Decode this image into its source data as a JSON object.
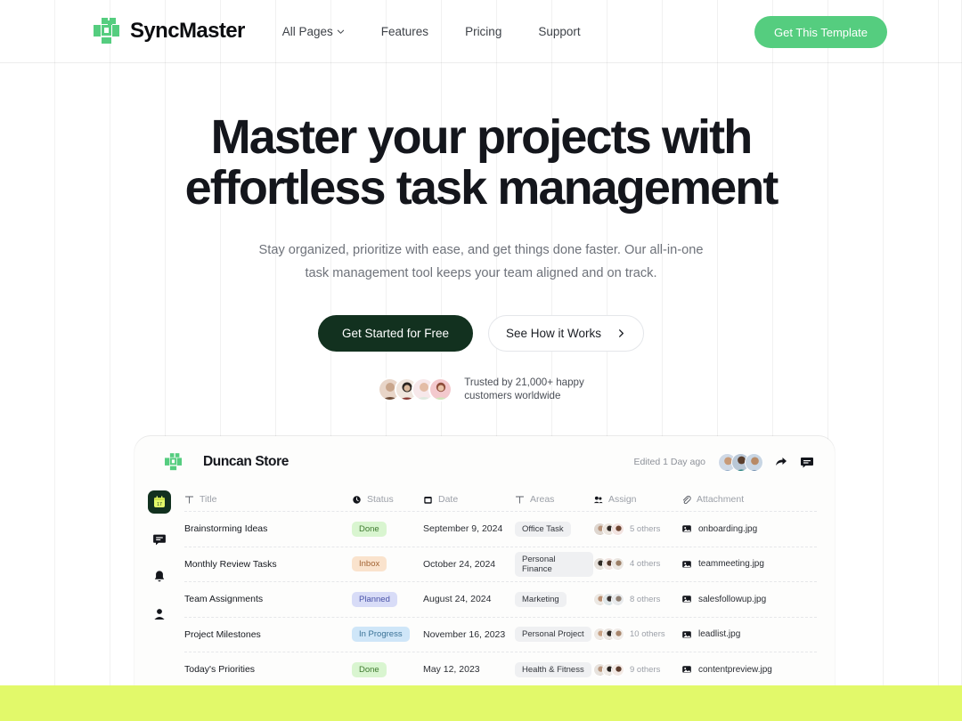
{
  "brand": {
    "name": "SyncMaster",
    "logo_icon": "syncmaster-logo-icon"
  },
  "nav": {
    "items": [
      {
        "label": "All Pages",
        "has_dropdown": true
      },
      {
        "label": "Features",
        "has_dropdown": false
      },
      {
        "label": "Pricing",
        "has_dropdown": false
      },
      {
        "label": "Support",
        "has_dropdown": false
      }
    ],
    "cta_label": "Get This Template",
    "cta_color": "#55cd7f"
  },
  "hero": {
    "heading_line1": "Master your projects with",
    "heading_line2": "effortless task management",
    "subheading": "Stay organized, prioritize with ease, and get things done faster. Our all-in-one task management tool keeps your team aligned and on track.",
    "primary_button": "Get Started for Free",
    "secondary_button": "See How it Works",
    "primary_button_color": "#12311f",
    "trusted_line1": "Trusted by 21,000+ happy",
    "trusted_line2": "customers worldwide"
  },
  "mockup": {
    "workspace_title": "Duncan Store",
    "edited_label": "Edited 1 Day ago",
    "share_icon": "share-arrow-icon",
    "comment_icon": "comment-icon",
    "sidebar_icons": [
      {
        "name": "calendar-icon",
        "active": true
      },
      {
        "name": "message-icon",
        "active": false
      },
      {
        "name": "bell-icon",
        "active": false
      },
      {
        "name": "person-icon",
        "active": false
      }
    ],
    "columns": [
      {
        "label": "Title",
        "icon": "text-icon"
      },
      {
        "label": "Status",
        "icon": "status-circle-icon"
      },
      {
        "label": "Date",
        "icon": "calendar-small-icon"
      },
      {
        "label": "Areas",
        "icon": "text-icon"
      },
      {
        "label": "Assign",
        "icon": "people-icon"
      },
      {
        "label": "Attachment",
        "icon": "paperclip-icon"
      }
    ],
    "rows": [
      {
        "title": "Brainstorming Ideas",
        "status": "Done",
        "status_style": "b-done",
        "date": "September 9, 2024",
        "area": "Office Task",
        "assign_others": "5 others",
        "attachment": "onboarding.jpg"
      },
      {
        "title": "Monthly Review Tasks",
        "status": "Inbox",
        "status_style": "b-inbox",
        "date": "October 24, 2024",
        "area": "Personal Finance",
        "assign_others": "4 others",
        "attachment": "teammeeting.jpg"
      },
      {
        "title": "Team Assignments",
        "status": "Planned",
        "status_style": "b-planned",
        "date": "August 24, 2024",
        "area": "Marketing",
        "assign_others": "8 others",
        "attachment": "salesfollowup.jpg"
      },
      {
        "title": "Project Milestones",
        "status": "In Progress",
        "status_style": "b-prog",
        "date": "November 16, 2023",
        "area": "Personal Project",
        "assign_others": "10 others",
        "attachment": "leadlist.jpg"
      },
      {
        "title": "Today's Priorities",
        "status": "Done",
        "status_style": "b-done",
        "date": "May 12, 2023",
        "area": "Health & Fitness",
        "assign_others": "9 others",
        "attachment": "contentpreview.jpg"
      }
    ]
  },
  "footer_band": {
    "color": "#e2f96a"
  }
}
